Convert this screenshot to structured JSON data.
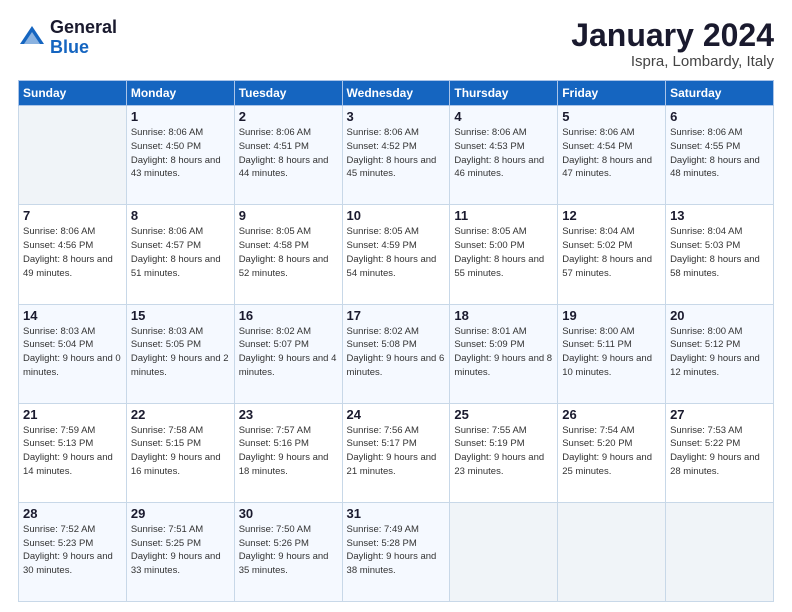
{
  "logo": {
    "general": "General",
    "blue": "Blue"
  },
  "header": {
    "month_year": "January 2024",
    "location": "Ispra, Lombardy, Italy"
  },
  "days_of_week": [
    "Sunday",
    "Monday",
    "Tuesday",
    "Wednesday",
    "Thursday",
    "Friday",
    "Saturday"
  ],
  "weeks": [
    [
      {
        "day": "",
        "info": ""
      },
      {
        "day": "1",
        "info": "Sunrise: 8:06 AM\nSunset: 4:50 PM\nDaylight: 8 hours\nand 43 minutes."
      },
      {
        "day": "2",
        "info": "Sunrise: 8:06 AM\nSunset: 4:51 PM\nDaylight: 8 hours\nand 44 minutes."
      },
      {
        "day": "3",
        "info": "Sunrise: 8:06 AM\nSunset: 4:52 PM\nDaylight: 8 hours\nand 45 minutes."
      },
      {
        "day": "4",
        "info": "Sunrise: 8:06 AM\nSunset: 4:53 PM\nDaylight: 8 hours\nand 46 minutes."
      },
      {
        "day": "5",
        "info": "Sunrise: 8:06 AM\nSunset: 4:54 PM\nDaylight: 8 hours\nand 47 minutes."
      },
      {
        "day": "6",
        "info": "Sunrise: 8:06 AM\nSunset: 4:55 PM\nDaylight: 8 hours\nand 48 minutes."
      }
    ],
    [
      {
        "day": "7",
        "info": "Sunrise: 8:06 AM\nSunset: 4:56 PM\nDaylight: 8 hours\nand 49 minutes."
      },
      {
        "day": "8",
        "info": "Sunrise: 8:06 AM\nSunset: 4:57 PM\nDaylight: 8 hours\nand 51 minutes."
      },
      {
        "day": "9",
        "info": "Sunrise: 8:05 AM\nSunset: 4:58 PM\nDaylight: 8 hours\nand 52 minutes."
      },
      {
        "day": "10",
        "info": "Sunrise: 8:05 AM\nSunset: 4:59 PM\nDaylight: 8 hours\nand 54 minutes."
      },
      {
        "day": "11",
        "info": "Sunrise: 8:05 AM\nSunset: 5:00 PM\nDaylight: 8 hours\nand 55 minutes."
      },
      {
        "day": "12",
        "info": "Sunrise: 8:04 AM\nSunset: 5:02 PM\nDaylight: 8 hours\nand 57 minutes."
      },
      {
        "day": "13",
        "info": "Sunrise: 8:04 AM\nSunset: 5:03 PM\nDaylight: 8 hours\nand 58 minutes."
      }
    ],
    [
      {
        "day": "14",
        "info": "Sunrise: 8:03 AM\nSunset: 5:04 PM\nDaylight: 9 hours\nand 0 minutes."
      },
      {
        "day": "15",
        "info": "Sunrise: 8:03 AM\nSunset: 5:05 PM\nDaylight: 9 hours\nand 2 minutes."
      },
      {
        "day": "16",
        "info": "Sunrise: 8:02 AM\nSunset: 5:07 PM\nDaylight: 9 hours\nand 4 minutes."
      },
      {
        "day": "17",
        "info": "Sunrise: 8:02 AM\nSunset: 5:08 PM\nDaylight: 9 hours\nand 6 minutes."
      },
      {
        "day": "18",
        "info": "Sunrise: 8:01 AM\nSunset: 5:09 PM\nDaylight: 9 hours\nand 8 minutes."
      },
      {
        "day": "19",
        "info": "Sunrise: 8:00 AM\nSunset: 5:11 PM\nDaylight: 9 hours\nand 10 minutes."
      },
      {
        "day": "20",
        "info": "Sunrise: 8:00 AM\nSunset: 5:12 PM\nDaylight: 9 hours\nand 12 minutes."
      }
    ],
    [
      {
        "day": "21",
        "info": "Sunrise: 7:59 AM\nSunset: 5:13 PM\nDaylight: 9 hours\nand 14 minutes."
      },
      {
        "day": "22",
        "info": "Sunrise: 7:58 AM\nSunset: 5:15 PM\nDaylight: 9 hours\nand 16 minutes."
      },
      {
        "day": "23",
        "info": "Sunrise: 7:57 AM\nSunset: 5:16 PM\nDaylight: 9 hours\nand 18 minutes."
      },
      {
        "day": "24",
        "info": "Sunrise: 7:56 AM\nSunset: 5:17 PM\nDaylight: 9 hours\nand 21 minutes."
      },
      {
        "day": "25",
        "info": "Sunrise: 7:55 AM\nSunset: 5:19 PM\nDaylight: 9 hours\nand 23 minutes."
      },
      {
        "day": "26",
        "info": "Sunrise: 7:54 AM\nSunset: 5:20 PM\nDaylight: 9 hours\nand 25 minutes."
      },
      {
        "day": "27",
        "info": "Sunrise: 7:53 AM\nSunset: 5:22 PM\nDaylight: 9 hours\nand 28 minutes."
      }
    ],
    [
      {
        "day": "28",
        "info": "Sunrise: 7:52 AM\nSunset: 5:23 PM\nDaylight: 9 hours\nand 30 minutes."
      },
      {
        "day": "29",
        "info": "Sunrise: 7:51 AM\nSunset: 5:25 PM\nDaylight: 9 hours\nand 33 minutes."
      },
      {
        "day": "30",
        "info": "Sunrise: 7:50 AM\nSunset: 5:26 PM\nDaylight: 9 hours\nand 35 minutes."
      },
      {
        "day": "31",
        "info": "Sunrise: 7:49 AM\nSunset: 5:28 PM\nDaylight: 9 hours\nand 38 minutes."
      },
      {
        "day": "",
        "info": ""
      },
      {
        "day": "",
        "info": ""
      },
      {
        "day": "",
        "info": ""
      }
    ]
  ]
}
